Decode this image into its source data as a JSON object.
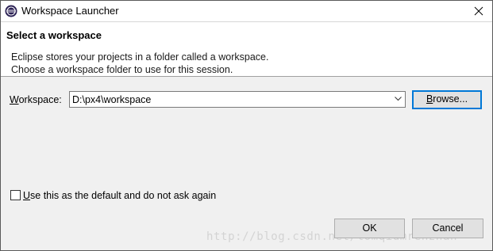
{
  "window": {
    "title": "Workspace Launcher",
    "app_icon": "eclipse-icon",
    "close_icon": "close-icon"
  },
  "header": {
    "title": "Select a workspace",
    "description_line1": "Eclipse stores your projects in a folder called a workspace.",
    "description_line2": "Choose a workspace folder to use for this session."
  },
  "workspace": {
    "label": "Workspace:",
    "value": "D:\\px4\\workspace",
    "browse_label": "Browse..."
  },
  "default_checkbox": {
    "label": "Use this as the default and do not ask again",
    "checked": false
  },
  "buttons": {
    "ok": "OK",
    "cancel": "Cancel"
  },
  "watermark": "http://blog.csdn.net/lomqiumrenzhan",
  "colors": {
    "accent": "#0078d7",
    "dialog_bg": "#f0f0f0",
    "header_bg": "#ffffff"
  }
}
